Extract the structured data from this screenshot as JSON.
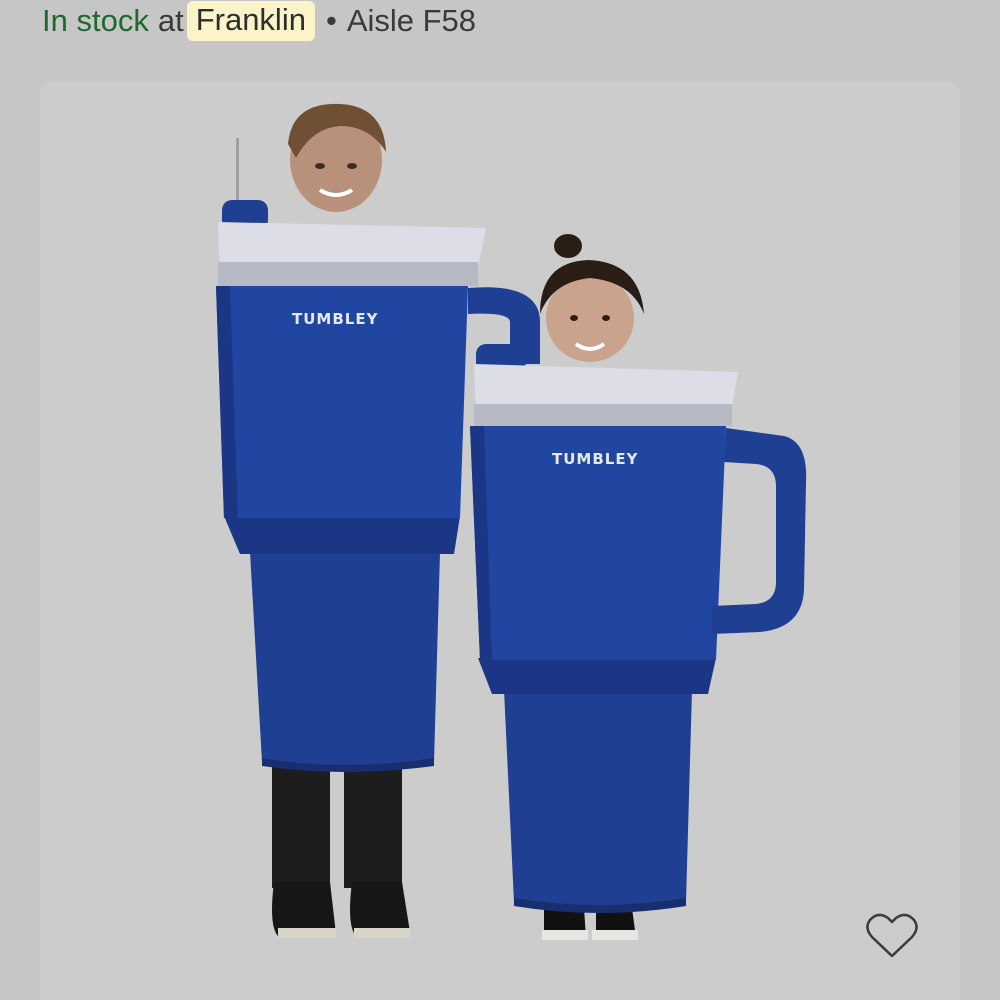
{
  "availability": {
    "status": "In stock",
    "connector": "at",
    "store": "Franklin",
    "separator": "•",
    "aisle": "Aisle F58"
  },
  "product_image": {
    "subject": "adult and child in blue tumbler costumes",
    "brand_logo": "TUMBLEY",
    "costume_color": "#1f3f93"
  },
  "favorite": {
    "icon": "heart-outline-icon"
  },
  "colors": {
    "in_stock": "#1f6a2a",
    "store_highlight": "#fbf4c9",
    "background": "#c6c6c6"
  }
}
